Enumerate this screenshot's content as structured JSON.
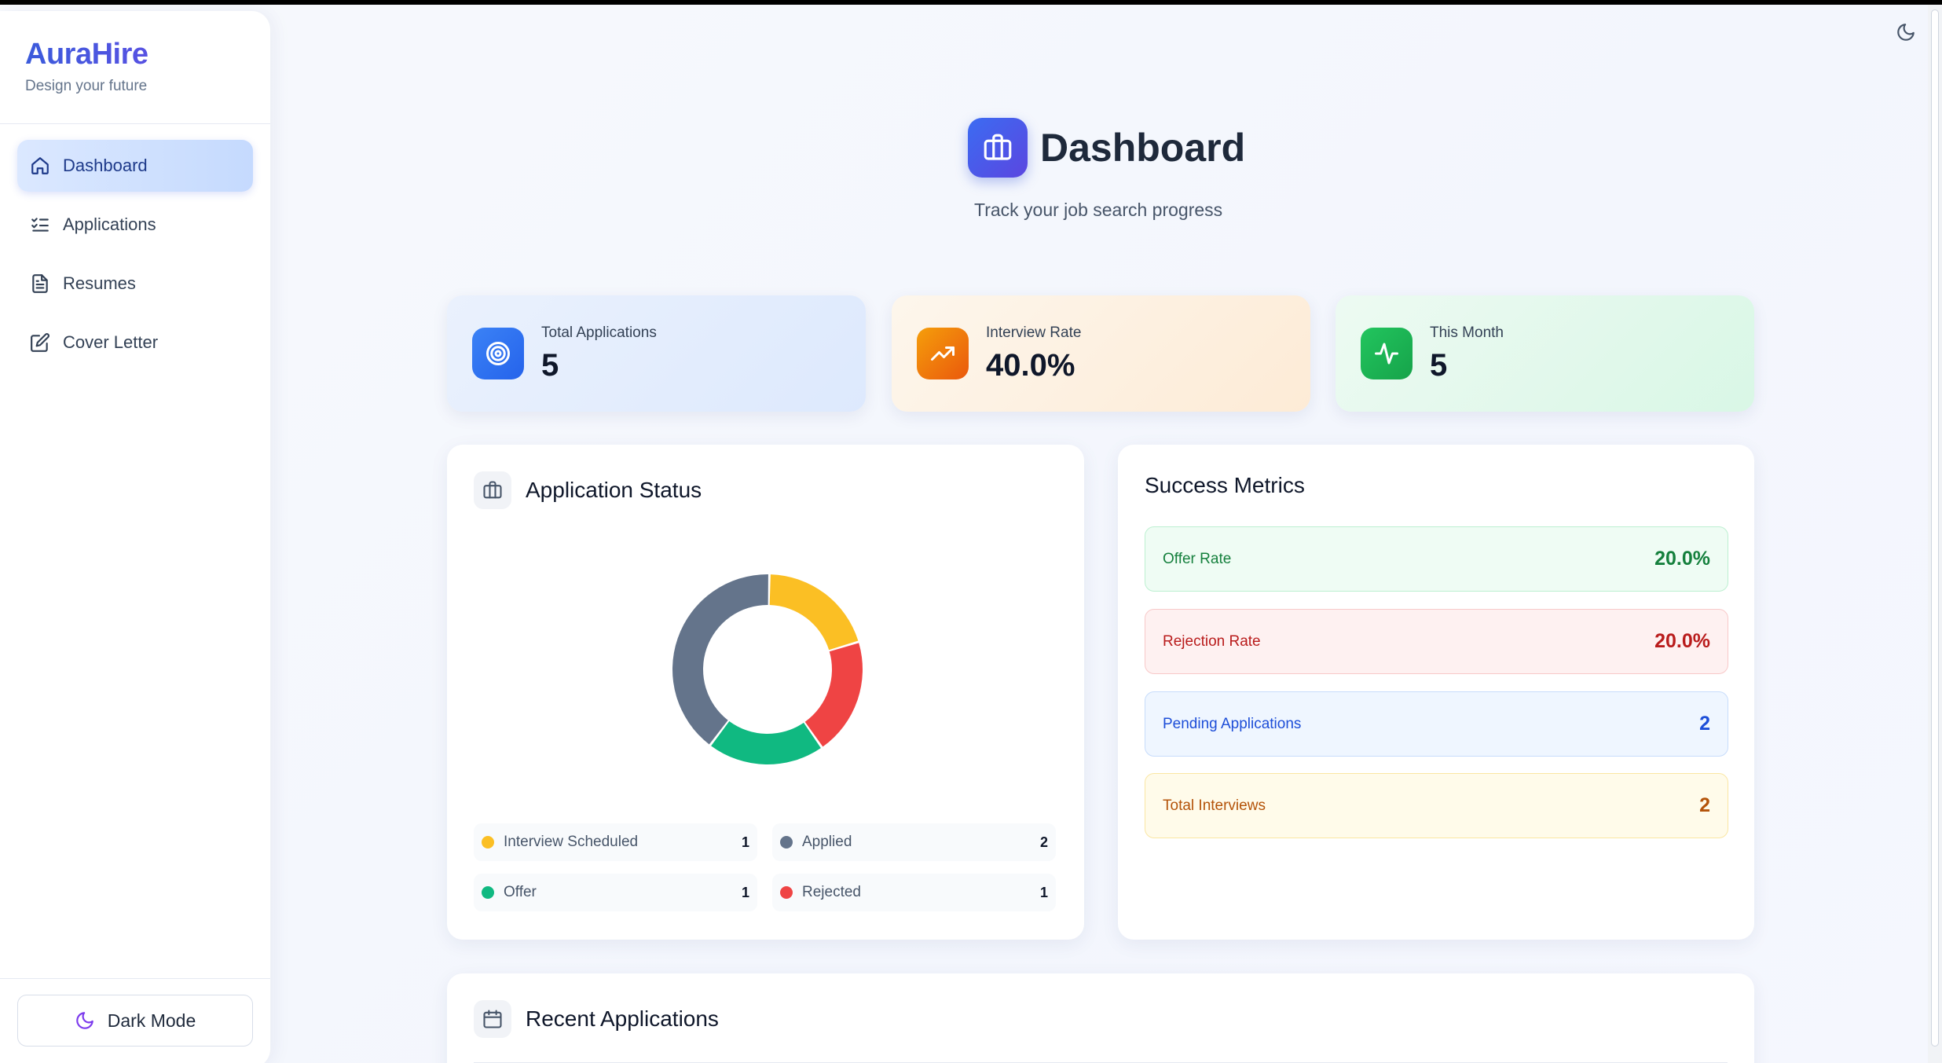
{
  "brand": {
    "title": "AuraHire",
    "subtitle": "Design your future"
  },
  "sidebar": {
    "items": [
      {
        "label": "Dashboard",
        "icon": "home-icon",
        "active": true
      },
      {
        "label": "Applications",
        "icon": "list-check-icon"
      },
      {
        "label": "Resumes",
        "icon": "file-icon"
      },
      {
        "label": "Cover Letter",
        "icon": "edit-icon"
      }
    ],
    "dark_mode_label": "Dark Mode"
  },
  "header": {
    "title": "Dashboard",
    "subtitle": "Track your job search progress"
  },
  "stats": [
    {
      "label": "Total Applications",
      "value": "5",
      "icon": "target-icon",
      "color": "#2563eb"
    },
    {
      "label": "Interview Rate",
      "value": "40.0%",
      "icon": "trending-up-icon",
      "color": "#ea580c"
    },
    {
      "label": "This Month",
      "value": "5",
      "icon": "activity-icon",
      "color": "#16a34a"
    }
  ],
  "application_status": {
    "title": "Application Status",
    "legend": [
      {
        "label": "Interview Scheduled",
        "value": "1",
        "color": "#fbbf24"
      },
      {
        "label": "Applied",
        "value": "2",
        "color": "#64748b"
      },
      {
        "label": "Offer",
        "value": "1",
        "color": "#10b981"
      },
      {
        "label": "Rejected",
        "value": "1",
        "color": "#ef4444"
      }
    ]
  },
  "chart_data": {
    "type": "pie",
    "categories": [
      "Interview Scheduled",
      "Rejected",
      "Offer",
      "Applied"
    ],
    "values": [
      1,
      1,
      1,
      2
    ],
    "colors": [
      "#fbbf24",
      "#ef4444",
      "#10b981",
      "#64748b"
    ]
  },
  "success_metrics": {
    "title": "Success Metrics",
    "items": [
      {
        "label": "Offer Rate",
        "value": "20.0%",
        "tone": "green"
      },
      {
        "label": "Rejection Rate",
        "value": "20.0%",
        "tone": "red"
      },
      {
        "label": "Pending Applications",
        "value": "2",
        "tone": "blue"
      },
      {
        "label": "Total Interviews",
        "value": "2",
        "tone": "yellow"
      }
    ]
  },
  "recent": {
    "title": "Recent Applications"
  }
}
